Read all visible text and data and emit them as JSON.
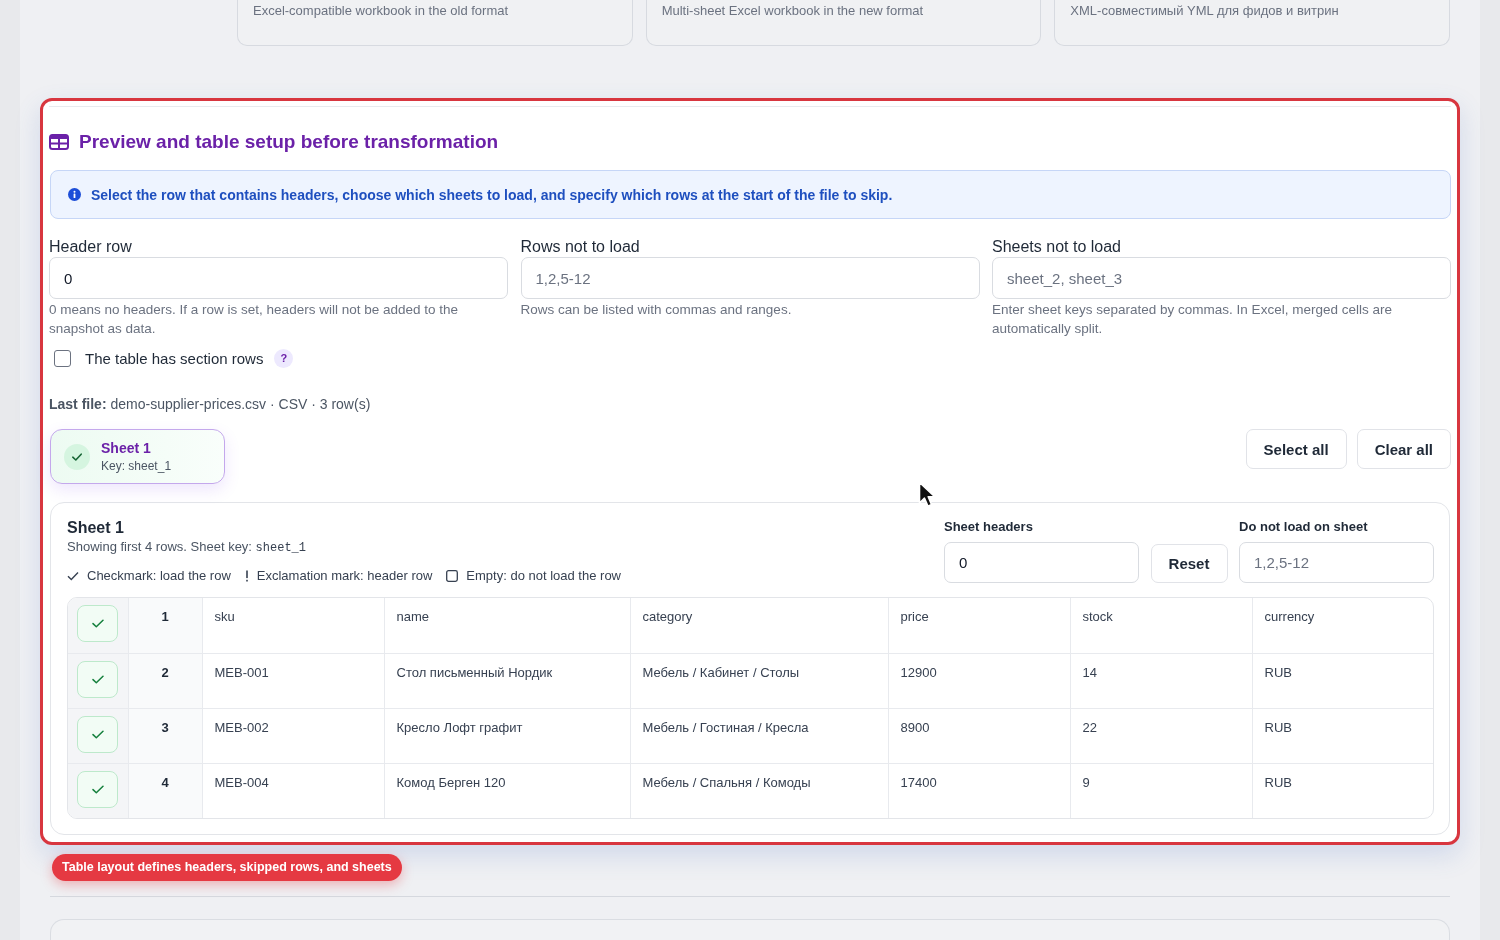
{
  "format_cards": [
    {
      "description": "Excel-compatible workbook in the old format"
    },
    {
      "description": "Multi-sheet Excel workbook in the new format"
    },
    {
      "description": "XML-совместимый YML для фидов и витрин"
    }
  ],
  "section": {
    "title": "Preview and table setup before transformation",
    "info": "Select the row that contains headers, choose which sheets to load, and specify which rows at the start of the file to skip.",
    "fields": [
      {
        "label": "Header row",
        "value": "0",
        "hint": "0 means no headers. If a row is set, headers will not be added to the snapshot as data."
      },
      {
        "label": "Rows not to load",
        "placeholder": "1,2,5-12",
        "hint": "Rows can be listed with commas and ranges."
      },
      {
        "label": "Sheets not to load",
        "placeholder": "sheet_2, sheet_3",
        "hint": "Enter sheet keys separated by commas. In Excel, merged cells are automatically split."
      }
    ],
    "section_rows_checkbox": {
      "label": "The table has section rows",
      "checked": false,
      "help": "?"
    },
    "last_file": "**Last file:** demo-supplier-prices.csv · CSV · 3 row(s)",
    "sheets": [
      {
        "name": "Sheet 1",
        "key_label": "Key: sheet_1",
        "selected": true
      }
    ],
    "buttons": [
      "Select all",
      "Clear all"
    ],
    "sheet_panel": {
      "title": "Sheet 1",
      "subtitle": "Showing first 4 rows. Sheet key: ",
      "sheet_key": "sheet_1",
      "legend": [
        {
          "kind": "load",
          "text": "Checkmark: load the row"
        },
        {
          "kind": "header",
          "text": "Exclamation mark: header row"
        },
        {
          "kind": "skip",
          "text": "Empty: do not load the row"
        }
      ],
      "headers_field": {
        "label": "Sheet headers",
        "value": "0"
      },
      "reset_button": "Reset",
      "skip_field": {
        "label": "Do not load on sheet",
        "placeholder": "1,2,5-12"
      },
      "rows": [
        {
          "number": "1",
          "checked": true,
          "header": false,
          "cells": [
            "sku",
            "name",
            "category",
            "price",
            "stock",
            "currency"
          ]
        },
        {
          "number": "2",
          "checked": true,
          "header": false,
          "cells": [
            "MEB-001",
            "Стол письменный Нордик",
            "Мебель / Кабинет / Столы",
            "12900",
            "14",
            "RUB"
          ]
        },
        {
          "number": "3",
          "checked": true,
          "header": false,
          "cells": [
            "MEB-002",
            "Кресло Лофт графит",
            "Мебель / Гостиная / Кресла",
            "8900",
            "22",
            "RUB"
          ]
        },
        {
          "number": "4",
          "checked": true,
          "header": false,
          "cells": [
            "MEB-004",
            "Комод Берген 120",
            "Мебель / Спальня / Комоды",
            "17400",
            "9",
            "RUB"
          ]
        }
      ]
    }
  },
  "annotation": "Table layout defines headers, skipped rows, and sheets"
}
